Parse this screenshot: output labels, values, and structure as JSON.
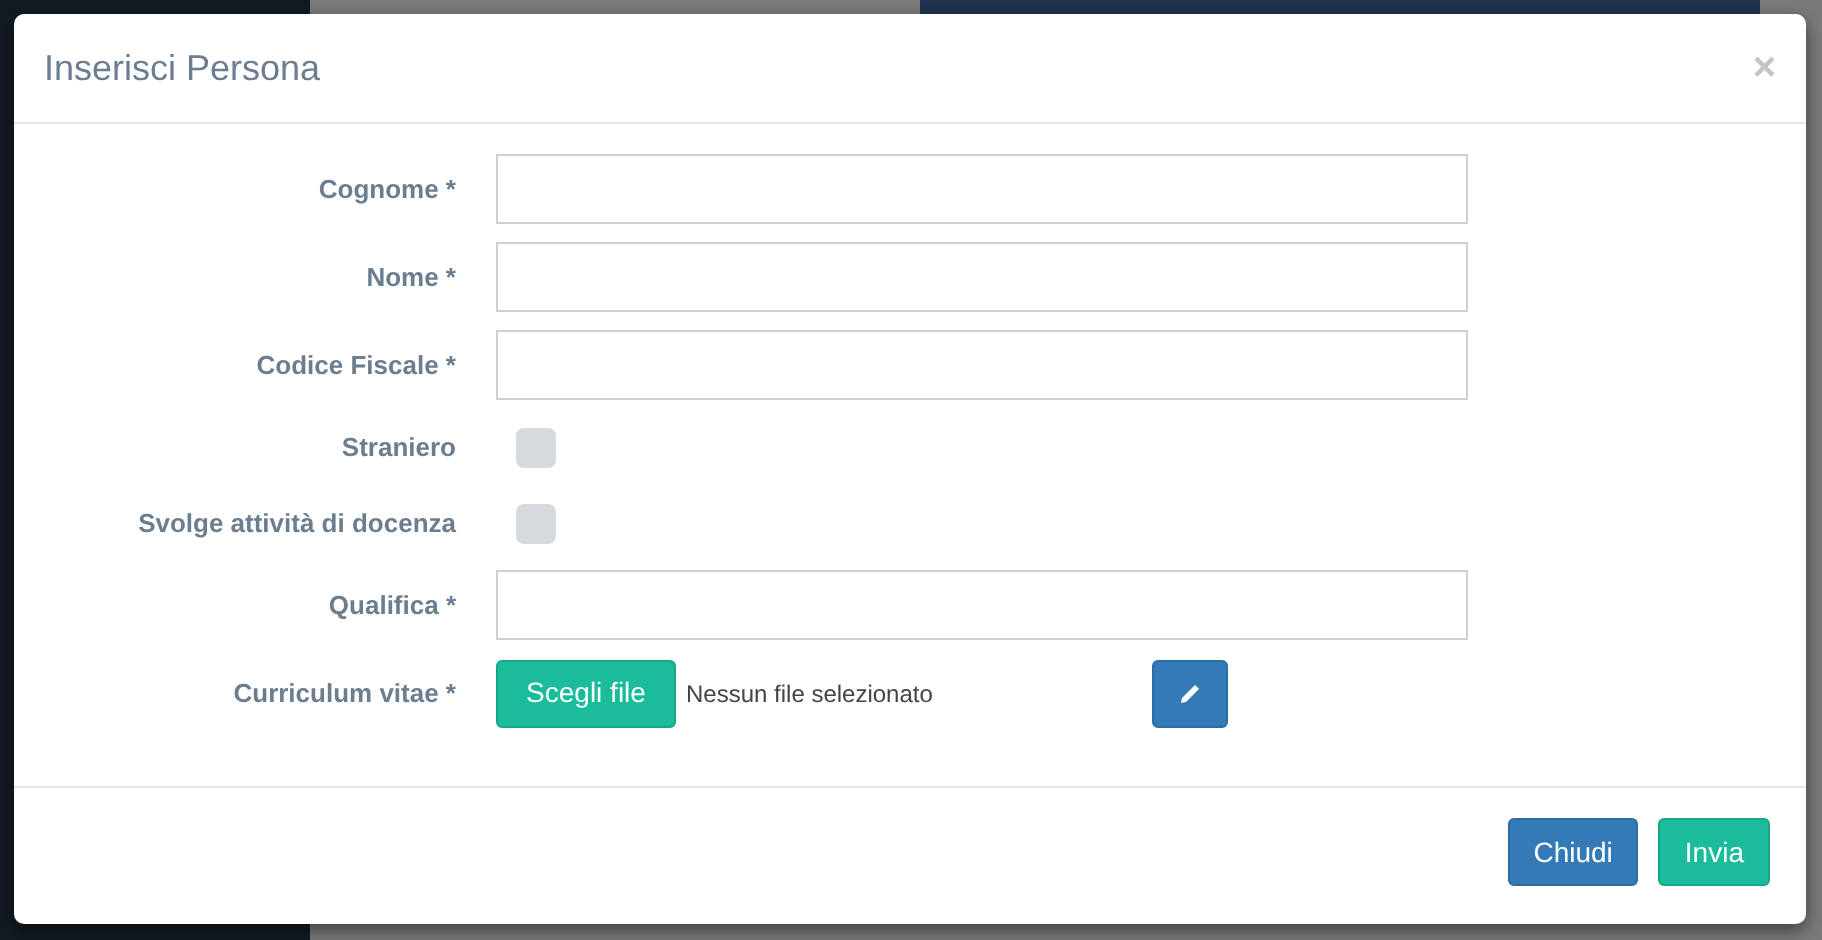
{
  "modal": {
    "title": "Inserisci Persona",
    "close_label": "×"
  },
  "form": {
    "fields": [
      {
        "kind": "text",
        "label": "Cognome *"
      },
      {
        "kind": "text",
        "label": "Nome *"
      },
      {
        "kind": "text",
        "label": "Codice Fiscale *"
      },
      {
        "kind": "checkbox",
        "label": "Straniero",
        "checked": false
      },
      {
        "kind": "checkbox",
        "label": "Svolge attività di docenza",
        "checked": false
      },
      {
        "kind": "text",
        "label": "Qualifica *"
      },
      {
        "kind": "file",
        "label": "Curriculum vitae *",
        "button": "Scegli file",
        "status": "Nessun file selezionato"
      }
    ]
  },
  "footer": {
    "buttons": [
      {
        "label": "Chiudi",
        "kind": "primary"
      },
      {
        "label": "Invia",
        "kind": "success"
      }
    ]
  }
}
